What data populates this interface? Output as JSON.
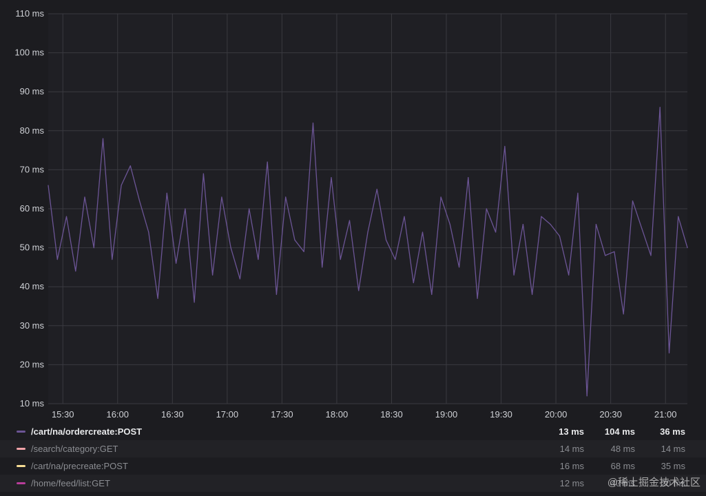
{
  "chart_data": {
    "type": "line",
    "yunit": "ms",
    "ylim": [
      10,
      110
    ],
    "ytick_labels": [
      "110 ms",
      "100 ms",
      "90 ms",
      "80 ms",
      "70 ms",
      "60 ms",
      "50 ms",
      "40 ms",
      "30 ms",
      "20 ms",
      "10 ms"
    ],
    "ytick_values": [
      110,
      100,
      90,
      80,
      70,
      60,
      50,
      40,
      30,
      20,
      10
    ],
    "xtick_labels": [
      "15:30",
      "16:00",
      "16:30",
      "17:00",
      "17:30",
      "18:00",
      "18:30",
      "19:00",
      "19:30",
      "20:00",
      "20:30",
      "21:00"
    ],
    "xlim": [
      "15:22",
      "21:12"
    ],
    "grid": true,
    "legend_placement": "bottom",
    "series": [
      {
        "name": "/cart/na/ordercreate:POST",
        "color": "#6c5596",
        "x": [
          "15:22",
          "15:27",
          "15:32",
          "15:37",
          "15:42",
          "15:47",
          "15:52",
          "15:57",
          "16:02",
          "16:07",
          "16:12",
          "16:17",
          "16:22",
          "16:27",
          "16:32",
          "16:37",
          "16:42",
          "16:47",
          "16:52",
          "16:57",
          "17:02",
          "17:07",
          "17:12",
          "17:17",
          "17:22",
          "17:27",
          "17:32",
          "17:37",
          "17:42",
          "17:47",
          "17:52",
          "17:57",
          "18:02",
          "18:07",
          "18:12",
          "18:17",
          "18:22",
          "18:27",
          "18:32",
          "18:37",
          "18:42",
          "18:47",
          "18:52",
          "18:57",
          "19:02",
          "19:07",
          "19:12",
          "19:17",
          "19:22",
          "19:27",
          "19:32",
          "19:37",
          "19:42",
          "19:47",
          "19:52",
          "19:57",
          "20:02",
          "20:07",
          "20:12",
          "20:17",
          "20:22",
          "20:27",
          "20:32",
          "20:37",
          "20:42",
          "20:47",
          "20:52",
          "20:57",
          "21:02",
          "21:07",
          "21:12"
        ],
        "values": [
          66,
          47,
          58,
          44,
          63,
          50,
          78,
          47,
          66,
          71,
          62,
          54,
          37,
          64,
          46,
          60,
          36,
          69,
          43,
          63,
          50,
          42,
          60,
          47,
          72,
          38,
          63,
          52,
          49,
          82,
          45,
          68,
          47,
          57,
          39,
          54,
          65,
          52,
          47,
          58,
          41,
          54,
          38,
          63,
          56,
          45,
          68,
          37,
          60,
          54,
          76,
          43,
          56,
          38,
          58,
          56,
          53,
          43,
          64,
          12,
          56,
          48,
          49,
          33,
          62,
          55,
          48,
          86,
          23,
          58,
          50
        ]
      }
    ],
    "legend": {
      "columns": [
        "min",
        "max",
        "avg"
      ],
      "rows": [
        {
          "name": "/cart/na/ordercreate:POST",
          "color": "#6c5596",
          "min": "13 ms",
          "max": "104 ms",
          "avg": "36 ms",
          "active": true
        },
        {
          "name": "/search/category:GET",
          "color": "#f2a4a9",
          "min": "14 ms",
          "max": "48 ms",
          "avg": "14 ms",
          "active": false
        },
        {
          "name": "/cart/na/precreate:POST",
          "color": "#f7dd94",
          "min": "16 ms",
          "max": "68 ms",
          "avg": "35 ms",
          "active": false
        },
        {
          "name": "/home/feed/list:GET",
          "color": "#b83d9a",
          "min": "12 ms",
          "max": "40 ms",
          "avg": "20 ms",
          "active": false
        }
      ]
    }
  },
  "watermark": "@稀土掘金技术社区"
}
